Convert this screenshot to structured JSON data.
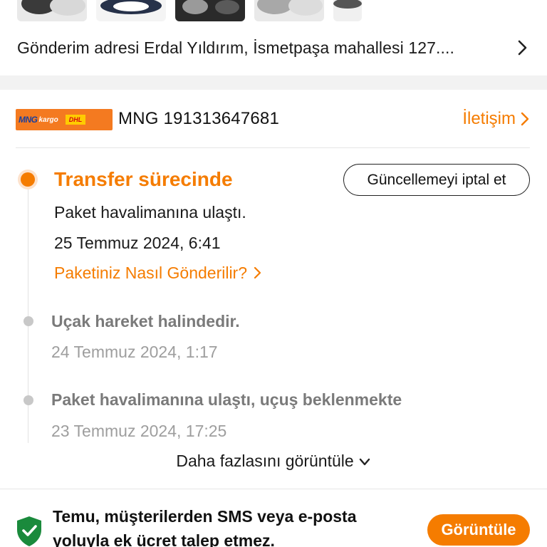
{
  "shipping": {
    "address_label": "Gönderim adresi Erdal Yıldırım, İsmetpaşa mahallesi 127...."
  },
  "carrier": {
    "tracking": "MNG  191313647681",
    "contact_label": "İletişim"
  },
  "timeline": {
    "current": {
      "title": "Transfer sürecinde",
      "description": "Paket havalimanına ulaştı.",
      "time": "25 Temmuz 2024, 6:41",
      "link": "Paketiniz Nasıl Gönderilir?",
      "cancel_button": "Güncellemeyi iptal et"
    },
    "past": [
      {
        "description": "Uçak hareket halindedir.",
        "time": "24 Temmuz 2024, 1:17"
      },
      {
        "description": "Paket havalimanına ulaştı, uçuş beklenmekte",
        "time": "23 Temmuz 2024, 17:25"
      }
    ],
    "more_label": "Daha fazlasını görüntüle"
  },
  "notice": {
    "text": "Temu, müşterilerden SMS veya e-posta yoluyla ek ücret talep etmez.",
    "button": "Görüntüle"
  },
  "colors": {
    "accent": "#f57c00",
    "shield": "#1a8a3c"
  }
}
